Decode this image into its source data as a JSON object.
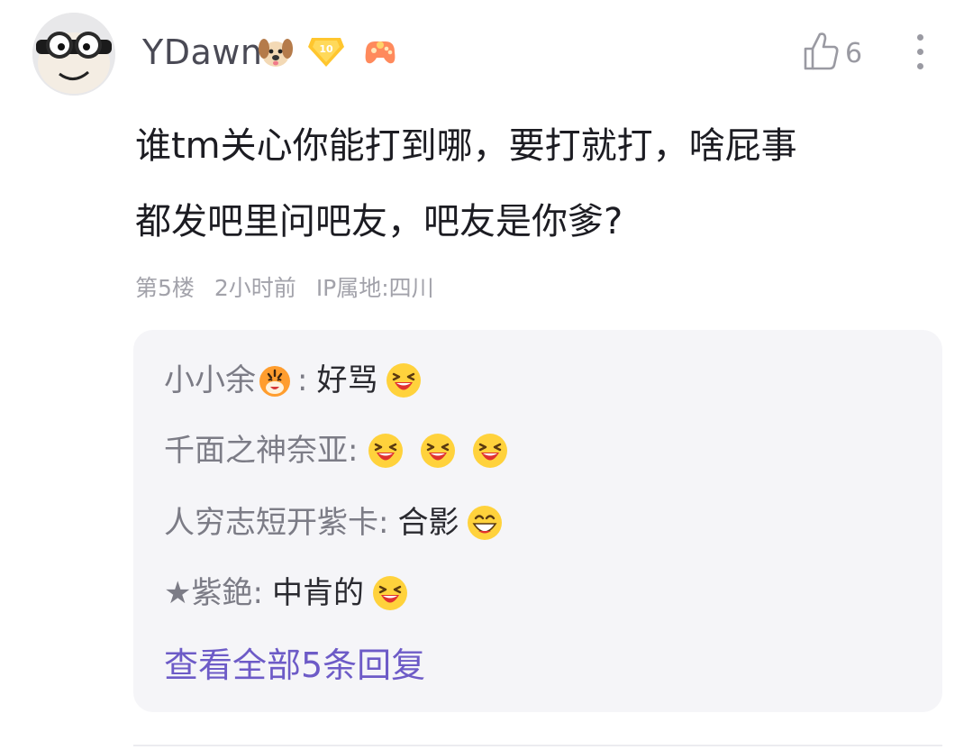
{
  "post": {
    "username": "YDawn",
    "level": "10",
    "like_count": "6",
    "content_line1": "谁tm关心你能打到哪，要打就打，啥屁事",
    "content_line2": "都发吧里问吧友，吧友是你爹?",
    "floor": "第5楼",
    "time": "2小时前",
    "ip": "IP属地:四川",
    "icons": {
      "avatar": "goggles-avatar",
      "name_emoji": "dog-face-icon",
      "level_badge": "level-badge-icon",
      "game_badge": "gamepad-icon",
      "like": "thumbs-up-icon",
      "more": "more-vertical-icon"
    }
  },
  "replies": [
    {
      "name": "小小余",
      "name_emoji": "tiger-face-icon",
      "sep": ":",
      "text": "好骂",
      "emojis": [
        "laughing-emoji-icon"
      ]
    },
    {
      "name": "千面之神奈亚",
      "sep": ":",
      "text": "",
      "emojis": [
        "laughing-emoji-icon",
        "laughing-emoji-icon",
        "laughing-emoji-icon"
      ]
    },
    {
      "name": "人穷志短开紫卡",
      "sep": ":",
      "text": "合影",
      "emojis": [
        "grinning-emoji-icon"
      ]
    },
    {
      "name": "★紫銫",
      "sep": ":",
      "text": "中肯的",
      "emojis": [
        "laughing-emoji-icon"
      ]
    }
  ],
  "view_all": "查看全部5条回复",
  "colors": {
    "link": "#6d5bc7",
    "reply_bg": "#f5f5f8",
    "name": "#4a4a55",
    "meta": "#a2a2aa"
  }
}
